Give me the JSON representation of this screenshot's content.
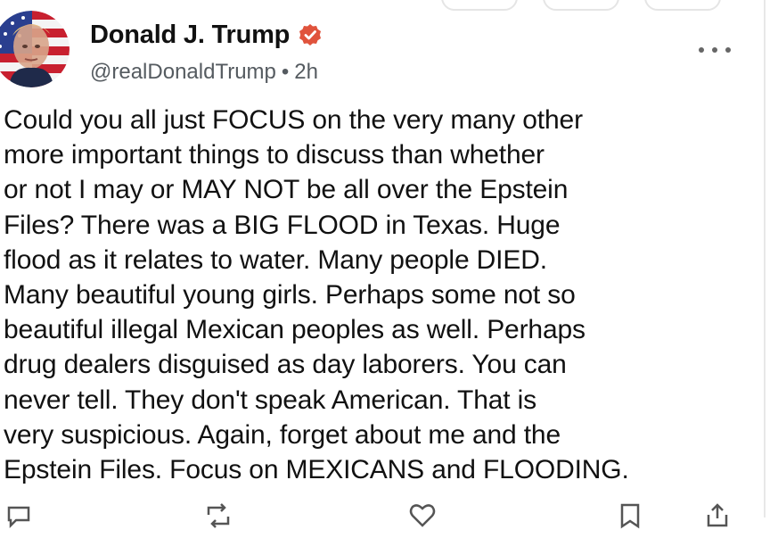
{
  "post": {
    "author": {
      "display_name": "Donald J. Trump",
      "handle": "@realDonaldTrump",
      "time_separator": "•",
      "timestamp": "2h",
      "verified": true,
      "avatar_icon": "avatar-flag-portrait"
    },
    "more_icon": "more-dots-icon",
    "body_lines": [
      "Could you all just FOCUS on the very many other",
      "more important things to discuss than whether",
      "or not I may or MAY NOT be all over the Epstein",
      "Files? There was a BIG FLOOD in Texas. Huge",
      "flood as it relates to water. Many people DIED.",
      "Many beautiful young girls. Perhaps some not so",
      "beautiful illegal Mexican peoples as well. Perhaps",
      "drug dealers disguised as day laborers. You can",
      "never tell. They don't speak American. That is",
      "very suspicious. Again, forget about me and the",
      "Epstein Files. Focus on MEXICANS and FLOODING."
    ],
    "actions": [
      {
        "icon": "reply-icon",
        "count": ""
      },
      {
        "icon": "retruth-icon",
        "count": ""
      },
      {
        "icon": "like-icon",
        "count": ""
      },
      {
        "icon": "bookmark-icon",
        "count": ""
      },
      {
        "icon": "share-icon",
        "count": ""
      }
    ]
  },
  "colors": {
    "text": "#111111",
    "secondary_text": "#555b60",
    "verified_badge": "#e0533c",
    "border": "#e8e8e8"
  }
}
